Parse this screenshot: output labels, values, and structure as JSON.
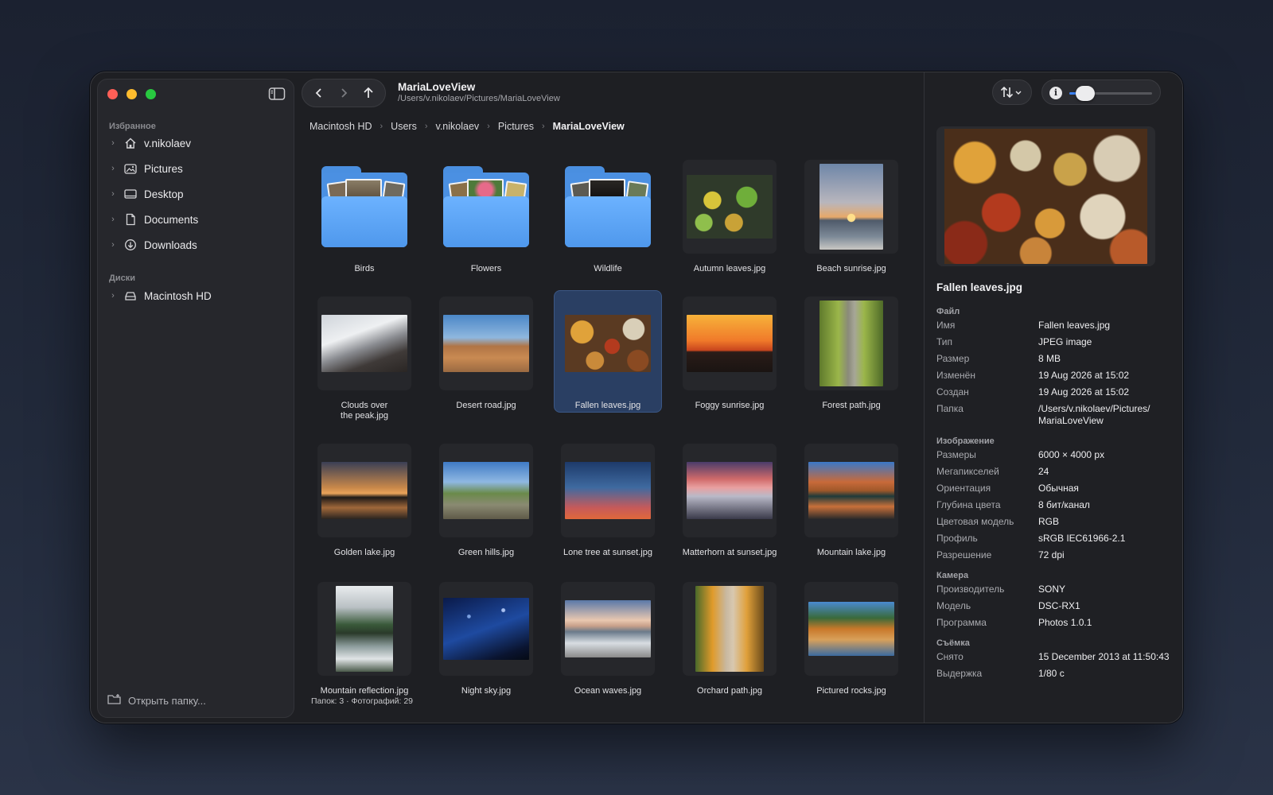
{
  "window": {
    "title": "MariaLoveView",
    "path": "/Users/v.nikolaev/Pictures/MariaLoveView"
  },
  "sidebar": {
    "favorites_title": "Избранное",
    "favorites": [
      {
        "label": "v.nikolaev",
        "icon": "home-icon"
      },
      {
        "label": "Pictures",
        "icon": "pictures-icon"
      },
      {
        "label": "Desktop",
        "icon": "desktop-icon"
      },
      {
        "label": "Documents",
        "icon": "document-icon"
      },
      {
        "label": "Downloads",
        "icon": "download-icon"
      }
    ],
    "disks_title": "Диски",
    "disks": [
      {
        "label": "Macintosh HD",
        "icon": "drive-icon"
      }
    ],
    "open_folder_label": "Открыть папку..."
  },
  "breadcrumb": [
    "Macintosh HD",
    "Users",
    "v.nikolaev",
    "Pictures",
    "MariaLoveView"
  ],
  "items": [
    {
      "label": "Birds",
      "kind": "folder"
    },
    {
      "label": "Flowers",
      "kind": "folder"
    },
    {
      "label": "Wildlife",
      "kind": "folder"
    },
    {
      "label": "Autumn leaves.jpg",
      "kind": "photo"
    },
    {
      "label": "Beach sunrise.jpg",
      "kind": "photo"
    },
    {
      "label": "Clouds over\nthe peak.jpg",
      "kind": "photo"
    },
    {
      "label": "Desert road.jpg",
      "kind": "photo"
    },
    {
      "label": "Fallen leaves.jpg",
      "kind": "photo",
      "selected": true
    },
    {
      "label": "Foggy sunrise.jpg",
      "kind": "photo"
    },
    {
      "label": "Forest path.jpg",
      "kind": "photo"
    },
    {
      "label": "Golden lake.jpg",
      "kind": "photo"
    },
    {
      "label": "Green hills.jpg",
      "kind": "photo"
    },
    {
      "label": "Lone tree at sunset.jpg",
      "kind": "photo"
    },
    {
      "label": "Matterhorn at sunset.jpg",
      "kind": "photo"
    },
    {
      "label": "Mountain lake.jpg",
      "kind": "photo"
    },
    {
      "label": "Mountain reflection.jpg",
      "kind": "photo"
    },
    {
      "label": "Night sky.jpg",
      "kind": "photo"
    },
    {
      "label": "Ocean waves.jpg",
      "kind": "photo"
    },
    {
      "label": "Orchard path.jpg",
      "kind": "photo"
    },
    {
      "label": "Pictured rocks.jpg",
      "kind": "photo"
    }
  ],
  "status": "Папок: 3 · Фотографий: 29",
  "inspector": {
    "zoom_level": 0.15,
    "file_title": "Fallen leaves.jpg",
    "sections": [
      {
        "title": "Файл",
        "rows": [
          [
            "Имя",
            "Fallen leaves.jpg"
          ],
          [
            "Тип",
            "JPEG image"
          ],
          [
            "Размер",
            "8 MB"
          ],
          [
            "Изменён",
            "19 Aug 2026 at 15:02"
          ],
          [
            "Создан",
            "19 Aug 2026 at 15:02"
          ],
          [
            "Папка",
            "/Users/v.nikolaev/Pictures/ MariaLoveView"
          ]
        ]
      },
      {
        "title": "Изображение",
        "rows": [
          [
            "Размеры",
            "6000 × 4000 px"
          ],
          [
            "Мегапикселей",
            "24"
          ],
          [
            "Ориентация",
            "Обычная"
          ],
          [
            "Глубина цвета",
            "8 бит/канал"
          ],
          [
            "Цветовая модель",
            "RGB"
          ],
          [
            "Профиль",
            "sRGB IEC61966-2.1"
          ],
          [
            "Разрешение",
            "72 dpi"
          ]
        ]
      },
      {
        "title": "Камера",
        "rows": [
          [
            "Производитель",
            "SONY"
          ],
          [
            "Модель",
            "DSC-RX1"
          ],
          [
            "Программа",
            "Photos 1.0.1"
          ]
        ]
      },
      {
        "title": "Съёмка",
        "rows": [
          [
            "Снято",
            "15 December 2013 at 11:50:43"
          ],
          [
            "Выдержка",
            "1/80 с"
          ]
        ]
      }
    ]
  },
  "colors": {
    "accent": "#3b82f6",
    "selection": "#2a3f63",
    "folder": "#5aa2f5"
  }
}
